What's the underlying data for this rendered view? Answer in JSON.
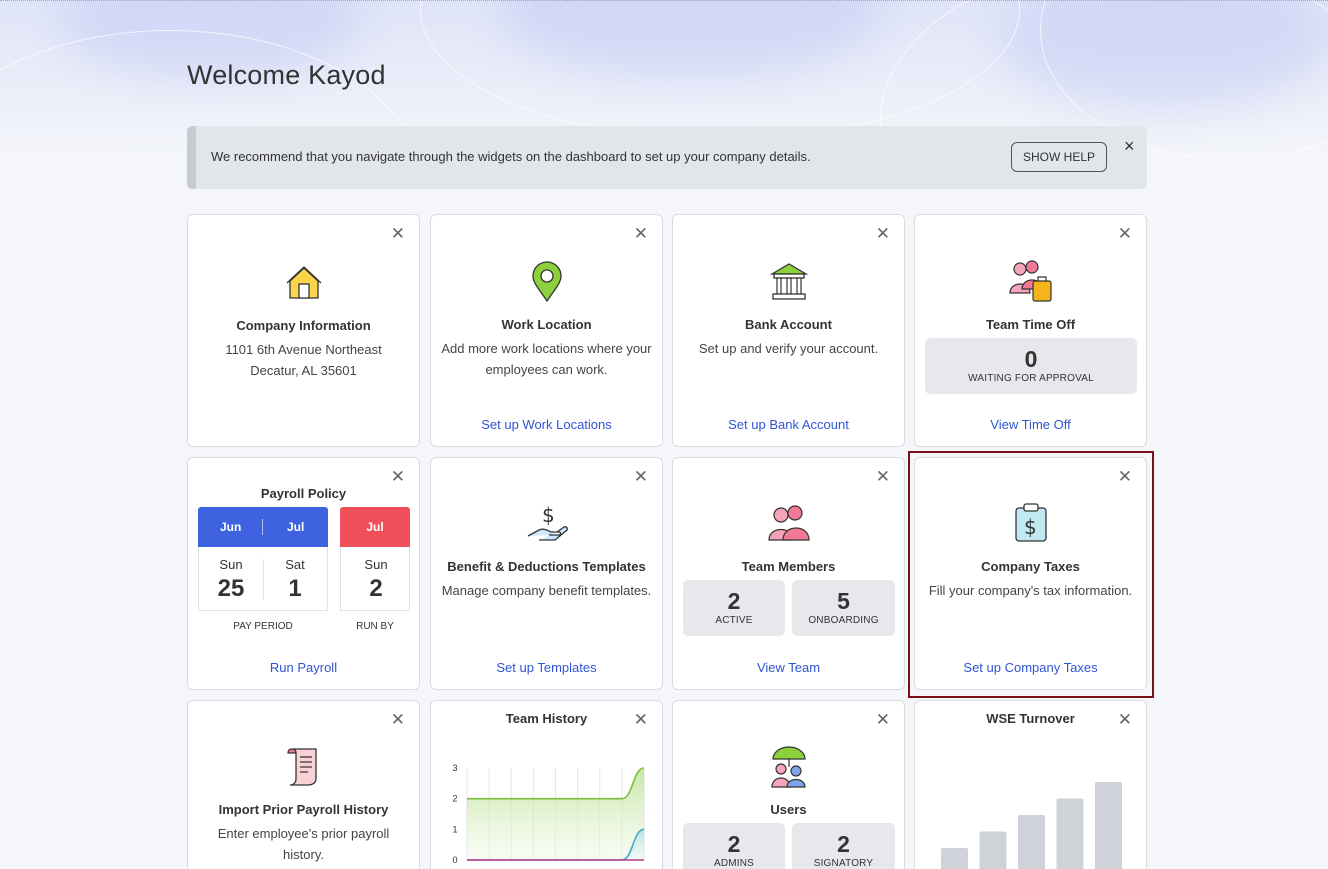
{
  "page": {
    "welcome": "Welcome Kayod"
  },
  "banner": {
    "message": "We recommend that you navigate through the widgets on the dashboard to set up your company details.",
    "show_help": "SHOW HELP",
    "close": "×"
  },
  "close_glyph": "✕",
  "widgets": {
    "company_info": {
      "title": "Company Information",
      "address_line1": "1101 6th Avenue Northeast",
      "address_line2": "Decatur, AL 35601",
      "icon": "house-icon"
    },
    "work_location": {
      "title": "Work Location",
      "desc": "Add more work locations where your employees can work.",
      "link": "Set up Work Locations",
      "icon": "map-pin-icon"
    },
    "bank_account": {
      "title": "Bank Account",
      "desc": "Set up and verify your account.",
      "link": "Set up Bank Account",
      "icon": "bank-icon"
    },
    "team_time_off": {
      "title": "Team Time Off",
      "count": "0",
      "count_label": "WAITING FOR APPROVAL",
      "link": "View Time Off",
      "icon": "travel-people-icon"
    },
    "payroll_policy": {
      "title": "Payroll Policy",
      "pay_period": {
        "start_month": "Jun",
        "end_month": "Jul",
        "start_day": "Sun",
        "start_date": "25",
        "end_day": "Sat",
        "end_date": "1",
        "caption": "PAY PERIOD"
      },
      "run_by": {
        "month": "Jul",
        "day": "Sun",
        "date": "2",
        "caption": "RUN BY"
      },
      "link": "Run Payroll",
      "colors": {
        "period_header": "#3f63e0",
        "runby_header": "#f0505a"
      }
    },
    "benefits": {
      "title": "Benefit & Deductions Templates",
      "desc": "Manage company benefit templates.",
      "link": "Set up Templates",
      "icon": "hand-dollar-icon"
    },
    "team_members": {
      "title": "Team Members",
      "active_count": "2",
      "active_label": "ACTIVE",
      "onboarding_count": "5",
      "onboarding_label": "ONBOARDING",
      "link": "View Team",
      "icon": "people-icon"
    },
    "company_taxes": {
      "title": "Company Taxes",
      "desc": "Fill your company's tax information.",
      "link": "Set up Company Taxes",
      "icon": "clipboard-dollar-icon"
    },
    "import_payroll": {
      "title": "Import Prior Payroll History",
      "desc": "Enter employee's prior payroll history.",
      "icon": "scroll-icon"
    },
    "team_history": {
      "title": "Team History"
    },
    "users": {
      "title": "Users",
      "admins_count": "2",
      "admins_label": "ADMINS",
      "signatory_count": "2",
      "signatory_label": "SIGNATORY",
      "icon": "umbrella-people-icon"
    },
    "wse_turnover": {
      "title": "WSE Turnover"
    }
  },
  "chart_data": [
    {
      "type": "area",
      "title": "Team History",
      "y_ticks": [
        "3",
        "2",
        "1",
        "0"
      ],
      "ylim": [
        0,
        3
      ],
      "grid": true,
      "series": [
        {
          "values": [
            2,
            2,
            2,
            2,
            2,
            2,
            2,
            2,
            3
          ],
          "color": "#7cbf3a"
        },
        {
          "values": [
            0,
            0,
            0,
            0,
            0,
            0,
            0,
            0,
            1
          ],
          "color": "#3ab0c8"
        },
        {
          "values": [
            0,
            0,
            0,
            0,
            0,
            0,
            0,
            0,
            0
          ],
          "color": "#c0398a"
        }
      ]
    },
    {
      "type": "bar",
      "title": "WSE Turnover",
      "values": [
        1,
        1.5,
        2,
        2.5,
        3
      ],
      "color": "#cfd3d9"
    }
  ]
}
